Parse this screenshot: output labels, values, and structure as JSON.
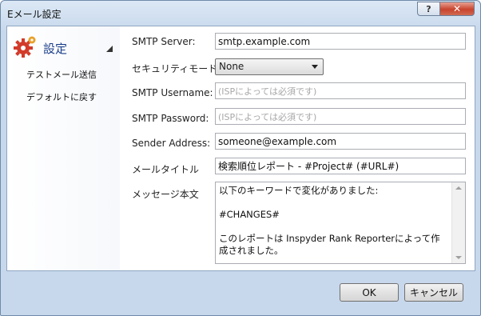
{
  "window": {
    "title": "Eメール設定",
    "help_label": "?",
    "close_label": "✕"
  },
  "sidebar": {
    "active": "設定",
    "items": [
      "テストメール送信",
      "デフォルトに戻す"
    ]
  },
  "form": {
    "smtp_server": {
      "label": "SMTP Server:",
      "value": "smtp.example.com"
    },
    "security_mode": {
      "label": "セキュリティモード",
      "value": "None"
    },
    "smtp_username": {
      "label": "SMTP Username:",
      "placeholder": "(ISPによっては必須です)"
    },
    "smtp_password": {
      "label": "SMTP Password:",
      "placeholder": "(ISPによっては必須です)"
    },
    "sender_address": {
      "label": "Sender Address:",
      "value": "someone@example.com"
    },
    "mail_title": {
      "label": "メールタイトル",
      "value": "検索順位レポート - #Project# (#URL#)"
    },
    "message_body": {
      "label": "メッセージ本文",
      "value": "以下のキーワードで変化がありました:\n\n#CHANGES#\n\nこのレポートは Inspyder Rank Reporterによって作成されました。"
    }
  },
  "buttons": {
    "ok": "OK",
    "cancel": "キャンセル"
  }
}
